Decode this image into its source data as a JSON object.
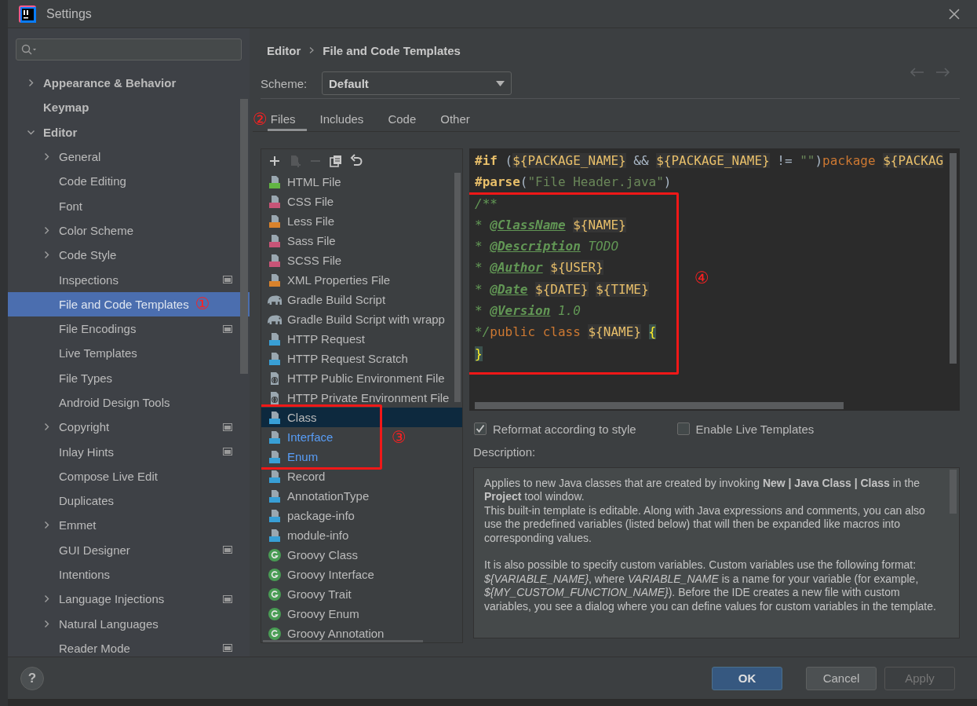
{
  "window": {
    "title": "Settings"
  },
  "sidebar": {
    "items": [
      {
        "label": "Appearance & Behavior",
        "expanded": false,
        "selected": false,
        "project": false
      },
      {
        "label": "Keymap",
        "selected": false,
        "project": false
      },
      {
        "label": "Editor",
        "expanded": true,
        "selected": false,
        "project": false,
        "children": [
          {
            "label": "General",
            "expanded": false,
            "selected": false,
            "project": false
          },
          {
            "label": "Code Editing",
            "selected": false,
            "project": false
          },
          {
            "label": "Font",
            "selected": false,
            "project": false
          },
          {
            "label": "Color Scheme",
            "expanded": false,
            "selected": false,
            "project": false
          },
          {
            "label": "Code Style",
            "expanded": false,
            "selected": false,
            "project": false
          },
          {
            "label": "Inspections",
            "selected": false,
            "project": true
          },
          {
            "label": "File and Code Templates",
            "selected": true,
            "project": false,
            "annotation": "①"
          },
          {
            "label": "File Encodings",
            "selected": false,
            "project": true
          },
          {
            "label": "Live Templates",
            "selected": false,
            "project": false
          },
          {
            "label": "File Types",
            "selected": false,
            "project": false
          },
          {
            "label": "Android Design Tools",
            "selected": false,
            "project": false
          },
          {
            "label": "Copyright",
            "expanded": false,
            "selected": false,
            "project": true
          },
          {
            "label": "Inlay Hints",
            "selected": false,
            "project": true
          },
          {
            "label": "Compose Live Edit",
            "selected": false,
            "project": false
          },
          {
            "label": "Duplicates",
            "selected": false,
            "project": false
          },
          {
            "label": "Emmet",
            "expanded": false,
            "selected": false,
            "project": false
          },
          {
            "label": "GUI Designer",
            "selected": false,
            "project": true
          },
          {
            "label": "Intentions",
            "selected": false,
            "project": false
          },
          {
            "label": "Language Injections",
            "expanded": false,
            "selected": false,
            "project": true
          },
          {
            "label": "Natural Languages",
            "expanded": false,
            "selected": false,
            "project": false
          },
          {
            "label": "Reader Mode",
            "selected": false,
            "project": true
          }
        ]
      }
    ]
  },
  "breadcrumb": [
    "Editor",
    "File and Code Templates"
  ],
  "scheme": {
    "label": "Scheme:",
    "value": "Default"
  },
  "tabs": [
    {
      "label": "Files",
      "selected": true,
      "annotation": "②"
    },
    {
      "label": "Includes",
      "selected": false
    },
    {
      "label": "Code",
      "selected": false
    },
    {
      "label": "Other",
      "selected": false
    }
  ],
  "templates": {
    "tools": [
      {
        "kind": "add",
        "disabled": false
      },
      {
        "kind": "add-child",
        "disabled": true
      },
      {
        "kind": "remove",
        "disabled": true
      },
      {
        "kind": "copy",
        "disabled": false
      },
      {
        "kind": "reset",
        "disabled": false
      }
    ],
    "items": [
      {
        "label": "HTML File",
        "kind": "html",
        "selected": false,
        "modified": false
      },
      {
        "label": "CSS File",
        "kind": "css",
        "selected": false,
        "modified": false
      },
      {
        "label": "Less File",
        "kind": "less",
        "selected": false,
        "modified": false
      },
      {
        "label": "Sass File",
        "kind": "sass",
        "selected": false,
        "modified": false
      },
      {
        "label": "SCSS File",
        "kind": "sass",
        "selected": false,
        "modified": false
      },
      {
        "label": "XML Properties File",
        "kind": "xml",
        "selected": false,
        "modified": false
      },
      {
        "label": "Gradle Build Script",
        "kind": "gradle",
        "selected": false,
        "modified": false
      },
      {
        "label": "Gradle Build Script with wrapp",
        "kind": "gradle",
        "selected": false,
        "modified": false
      },
      {
        "label": "HTTP Request",
        "kind": "api",
        "selected": false,
        "modified": false
      },
      {
        "label": "HTTP Request Scratch",
        "kind": "api",
        "selected": false,
        "modified": false
      },
      {
        "label": "HTTP Public Environment File",
        "kind": "env",
        "selected": false,
        "modified": false
      },
      {
        "label": "HTTP Private Environment File",
        "kind": "env",
        "selected": false,
        "modified": false
      },
      {
        "box": {
          "annotation": "③",
          "items": [
            {
              "label": "Class",
              "kind": "java",
              "selected": true,
              "modified": false
            },
            {
              "label": "Interface",
              "kind": "java",
              "selected": false,
              "modified": true
            },
            {
              "label": "Enum",
              "kind": "java",
              "selected": false,
              "modified": true
            }
          ]
        }
      },
      {
        "label": "Record",
        "kind": "java",
        "selected": false,
        "modified": false
      },
      {
        "label": "AnnotationType",
        "kind": "java",
        "selected": false,
        "modified": false
      },
      {
        "label": "package-info",
        "kind": "java",
        "selected": false,
        "modified": false
      },
      {
        "label": "module-info",
        "kind": "java",
        "selected": false,
        "modified": false
      },
      {
        "label": "Groovy Class",
        "kind": "groovy",
        "selected": false,
        "modified": false
      },
      {
        "label": "Groovy Interface",
        "kind": "groovy",
        "selected": false,
        "modified": false
      },
      {
        "label": "Groovy Trait",
        "kind": "groovy",
        "selected": false,
        "modified": false
      },
      {
        "label": "Groovy Enum",
        "kind": "groovy",
        "selected": false,
        "modified": false
      },
      {
        "label": "Groovy Annotation",
        "kind": "groovy",
        "selected": false,
        "modified": false
      }
    ]
  },
  "editor": {
    "lines": [
      {
        "tokens": [
          {
            "text": "#if",
            "kind": "directive"
          },
          {
            "text": "(",
            "kind": "plain",
            "gap": true
          },
          {
            "text": "${PACKAGE_NAME}",
            "kind": "var"
          },
          {
            "text": "&&",
            "kind": "plain",
            "gap": true
          },
          {
            "text": "${PACKAGE_NAME}",
            "kind": "var",
            "gap": true
          },
          {
            "text": "!=",
            "kind": "plain",
            "gap": true
          },
          {
            "text": "\"\"",
            "kind": "string",
            "gap": true
          },
          {
            "text": ")",
            "kind": "plain"
          },
          {
            "text": "package",
            "kind": "keyword"
          },
          {
            "text": "${PACKAG",
            "kind": "var",
            "gap": true
          }
        ]
      },
      {
        "tokens": [
          {
            "text": "#parse",
            "kind": "directive"
          },
          {
            "text": "(",
            "kind": "plain"
          },
          {
            "text": "\"File Header.java\"",
            "kind": "string"
          },
          {
            "text": ")",
            "kind": "plain"
          }
        ]
      },
      {
        "box": {
          "annotation": "④",
          "lines": [
            {
              "tokens": [
                {
                  "text": "/**",
                  "kind": "comment"
                }
              ]
            },
            {
              "tokens": [
                {
                  "text": "*",
                  "kind": "comment"
                },
                {
                  "text": "@ClassName",
                  "kind": "tag",
                  "gap": true
                },
                {
                  "text": "${NAME}",
                  "kind": "var",
                  "gap": true
                }
              ]
            },
            {
              "tokens": [
                {
                  "text": "*",
                  "kind": "comment"
                },
                {
                  "text": "@Description",
                  "kind": "tag",
                  "gap": true
                },
                {
                  "text": "TODO",
                  "kind": "comment",
                  "gap": true
                }
              ]
            },
            {
              "tokens": [
                {
                  "text": "*",
                  "kind": "comment"
                },
                {
                  "text": "@Author",
                  "kind": "tag",
                  "gap": true
                },
                {
                  "text": "${USER}",
                  "kind": "var",
                  "gap": true
                }
              ]
            },
            {
              "tokens": [
                {
                  "text": "*",
                  "kind": "comment"
                },
                {
                  "text": "@Date",
                  "kind": "tag",
                  "gap": true
                },
                {
                  "text": "${DATE}",
                  "kind": "var",
                  "gap": true
                },
                {
                  "text": "${TIME}",
                  "kind": "var",
                  "gap": true
                }
              ]
            },
            {
              "tokens": [
                {
                  "text": "*",
                  "kind": "comment"
                },
                {
                  "text": "@Version",
                  "kind": "tag",
                  "gap": true
                },
                {
                  "text": "1.0",
                  "kind": "comment",
                  "gap": true
                }
              ]
            },
            {
              "tokens": [
                {
                  "text": "*/",
                  "kind": "comment"
                },
                {
                  "text": "public class",
                  "kind": "keyword"
                },
                {
                  "text": "${NAME}",
                  "kind": "var",
                  "gap": true
                },
                {
                  "text": "{",
                  "kind": "brace",
                  "gap": true
                }
              ]
            },
            {
              "tokens": [
                {
                  "text": "}",
                  "kind": "brace"
                }
              ]
            }
          ]
        }
      }
    ]
  },
  "options": [
    {
      "label": "Reformat according to style",
      "checked": true
    },
    {
      "label": "Enable Live Templates",
      "checked": false
    }
  ],
  "description": {
    "label": "Description:",
    "paragraphs": [
      {
        "text": "Applies to new Java classes that are created by invoking **New | Java Class | Class** in the **Project** tool window.",
        "space_before": false
      },
      {
        "text": "This built-in template is editable. Along with Java expressions and comments, you can also use the predefined variables (listed below) that will then be expanded like macros into corresponding values.",
        "space_before": false
      },
      {
        "text": "It is also possible to specify custom variables. Custom variables use the following format: *${VARIABLE_NAME}*, where *VARIABLE_NAME* is a name for your variable (for example, *${MY_CUSTOM_FUNCTION_NAME}*). Before the IDE creates a new file with custom variables, you see a dialog where you can define values for custom variables in the template.",
        "space_before": true
      }
    ]
  },
  "help": "?",
  "buttons": [
    {
      "label": "OK",
      "default": true,
      "disabled": false
    },
    {
      "label": "Cancel",
      "default": false,
      "disabled": false
    },
    {
      "label": "Apply",
      "default": false,
      "disabled": true
    }
  ]
}
